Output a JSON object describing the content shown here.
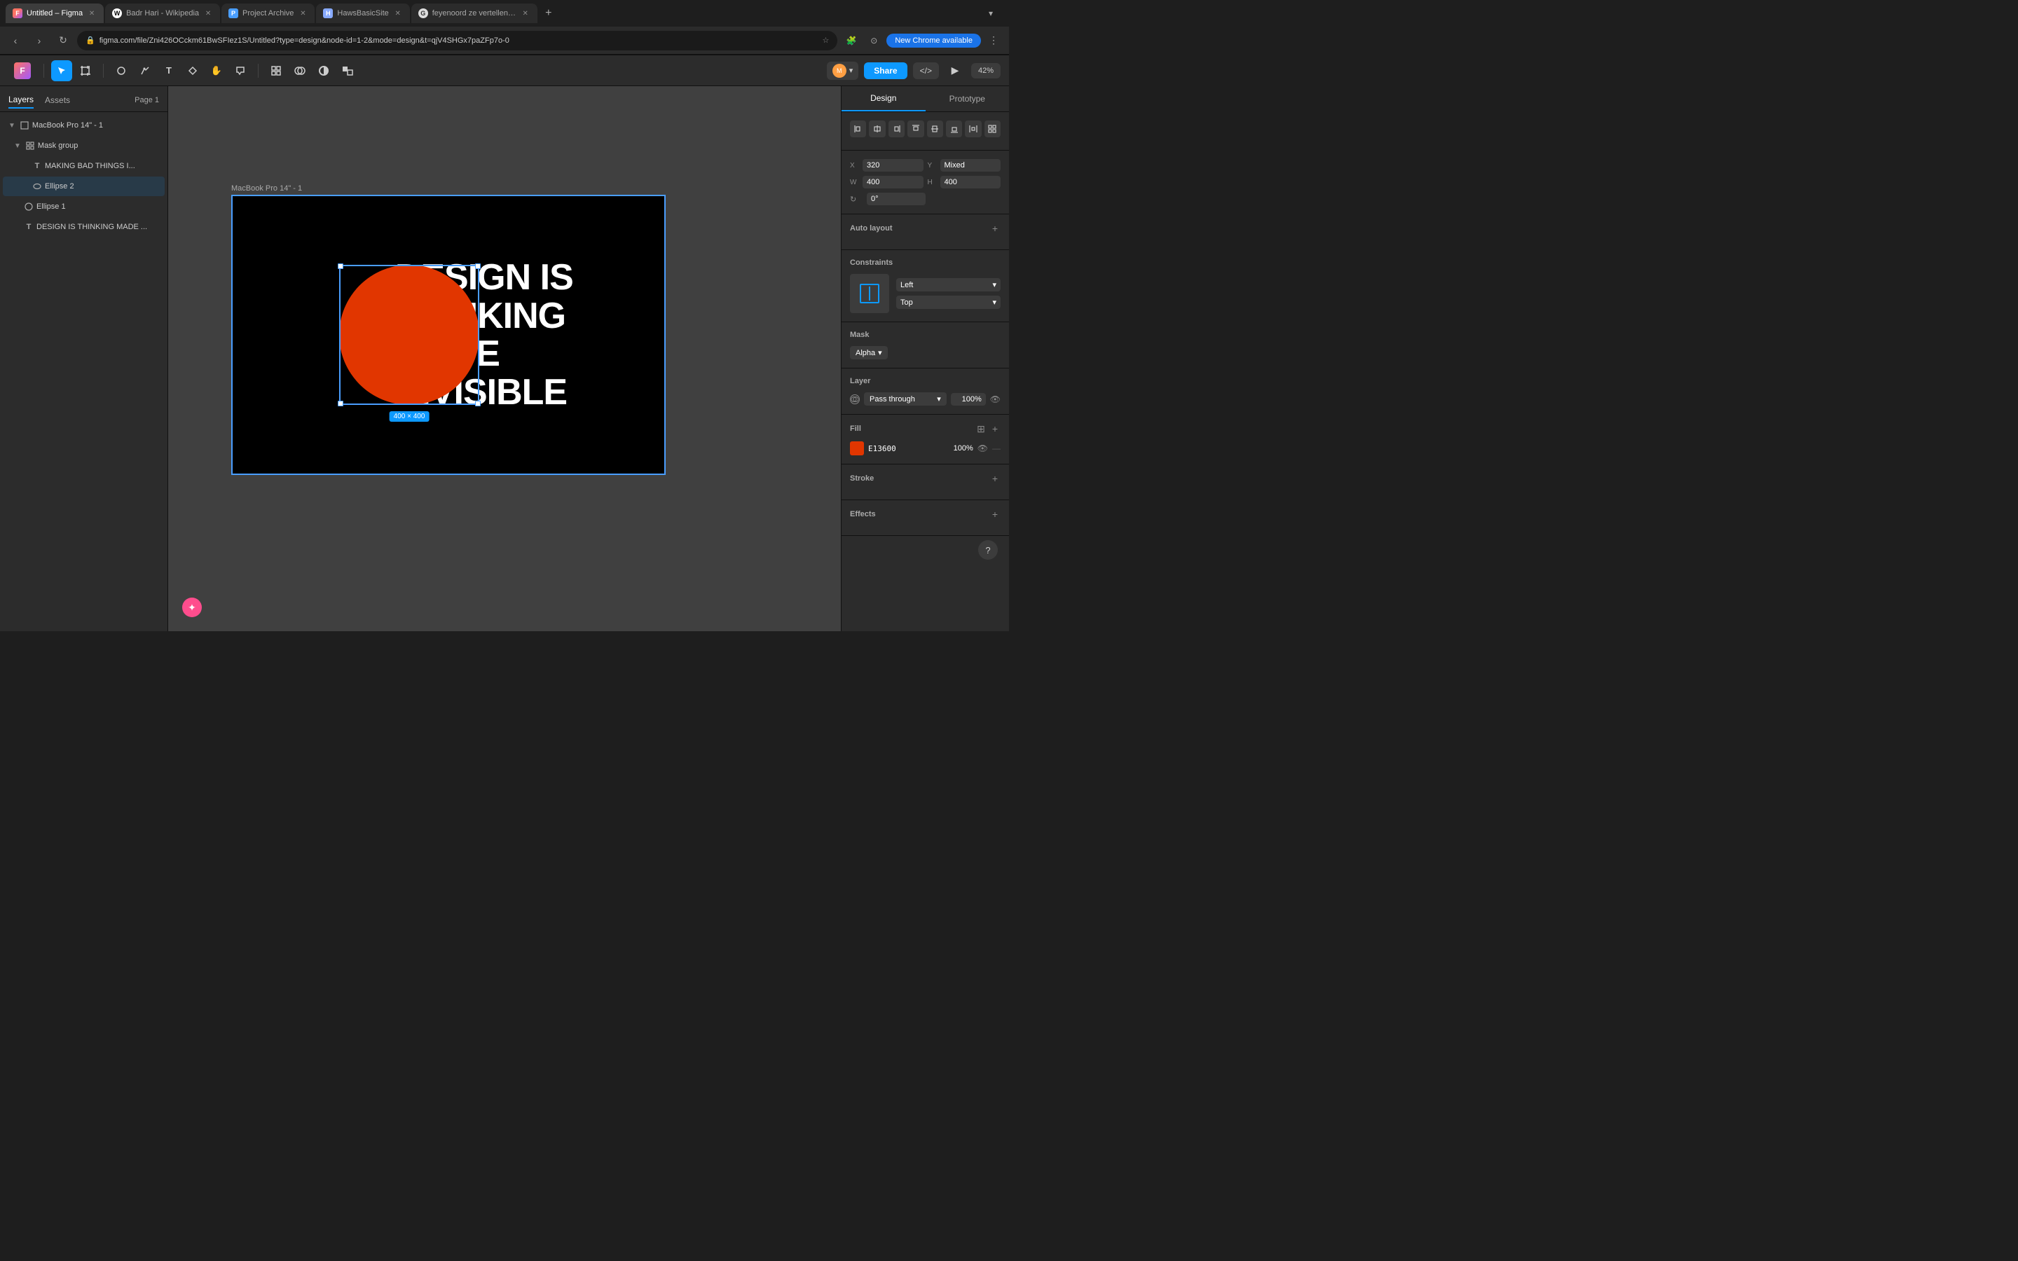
{
  "browser": {
    "tabs": [
      {
        "id": "figma",
        "favicon_color": "#ff4d4d",
        "favicon_letter": "F",
        "title": "Untitled – Figma",
        "active": true
      },
      {
        "id": "wikipedia",
        "favicon_color": "#fff",
        "favicon_letter": "W",
        "title": "Badr Hari - Wikipedia",
        "active": false
      },
      {
        "id": "project-archive",
        "favicon_color": "#4a9eff",
        "favicon_letter": "P",
        "title": "Project Archive",
        "active": false
      },
      {
        "id": "haws",
        "favicon_color": "#88aaff",
        "favicon_letter": "H",
        "title": "HawsBasicSite",
        "active": false
      },
      {
        "id": "feyenoord",
        "favicon_color": "#ddd",
        "favicon_letter": "G",
        "title": "feyenoord ze vertellen ons v...",
        "active": false
      }
    ],
    "url": "figma.com/file/Zni426OCckm61BwSFIez1S/Untitled?type=design&node-id=1-2&mode=design&t=qjV4SHGx7paZFp7o-0",
    "new_chrome_label": "New Chrome available"
  },
  "toolbar": {
    "zoom_level": "42%",
    "share_label": "Share"
  },
  "left_panel": {
    "tabs": [
      "Layers",
      "Assets"
    ],
    "page_label": "Page 1",
    "layers": [
      {
        "id": "macbook",
        "name": "MacBook Pro 14\" - 1",
        "icon": "frame",
        "indent": 0,
        "type": "frame"
      },
      {
        "id": "mask-group",
        "name": "Mask group",
        "icon": "group",
        "indent": 1,
        "type": "group"
      },
      {
        "id": "text1",
        "name": "MAKING BAD THINGS I...",
        "icon": "text",
        "indent": 2,
        "type": "text"
      },
      {
        "id": "ellipse2",
        "name": "Ellipse 2",
        "icon": "ellipse",
        "indent": 2,
        "type": "ellipse",
        "selected": true
      },
      {
        "id": "ellipse1",
        "name": "Ellipse 1",
        "icon": "ellipse",
        "indent": 1,
        "type": "ellipse"
      },
      {
        "id": "text2",
        "name": "DESIGN IS THINKING MADE ...",
        "icon": "text",
        "indent": 1,
        "type": "text"
      }
    ]
  },
  "canvas": {
    "frame_label": "MacBook Pro 14\" - 1",
    "frame_content": "DESIGN IS\nTHINKING\nMADE\nINVISIBLE",
    "circle_color": "#e13600",
    "selection_size": "400 × 400"
  },
  "right_panel": {
    "tabs": [
      "Design",
      "Prototype"
    ],
    "active_tab": "Design",
    "position": {
      "x_label": "X",
      "x_value": "320",
      "y_label": "Y",
      "y_value": "Mixed",
      "w_label": "W",
      "w_value": "400",
      "h_label": "H",
      "h_value": "400",
      "rotation_label": "↻",
      "rotation_value": "0°"
    },
    "auto_layout_label": "Auto layout",
    "constraints": {
      "title": "Constraints",
      "horizontal_label": "Left",
      "vertical_label": "Top"
    },
    "mask": {
      "title": "Mask",
      "mode": "Alpha"
    },
    "layer": {
      "title": "Layer",
      "blend_mode": "Pass through",
      "opacity": "100%"
    },
    "fill": {
      "title": "Fill",
      "color": "#E13600",
      "hex": "E13600",
      "opacity": "100%"
    },
    "stroke": {
      "title": "Stroke"
    },
    "effects": {
      "title": "Effects"
    }
  }
}
